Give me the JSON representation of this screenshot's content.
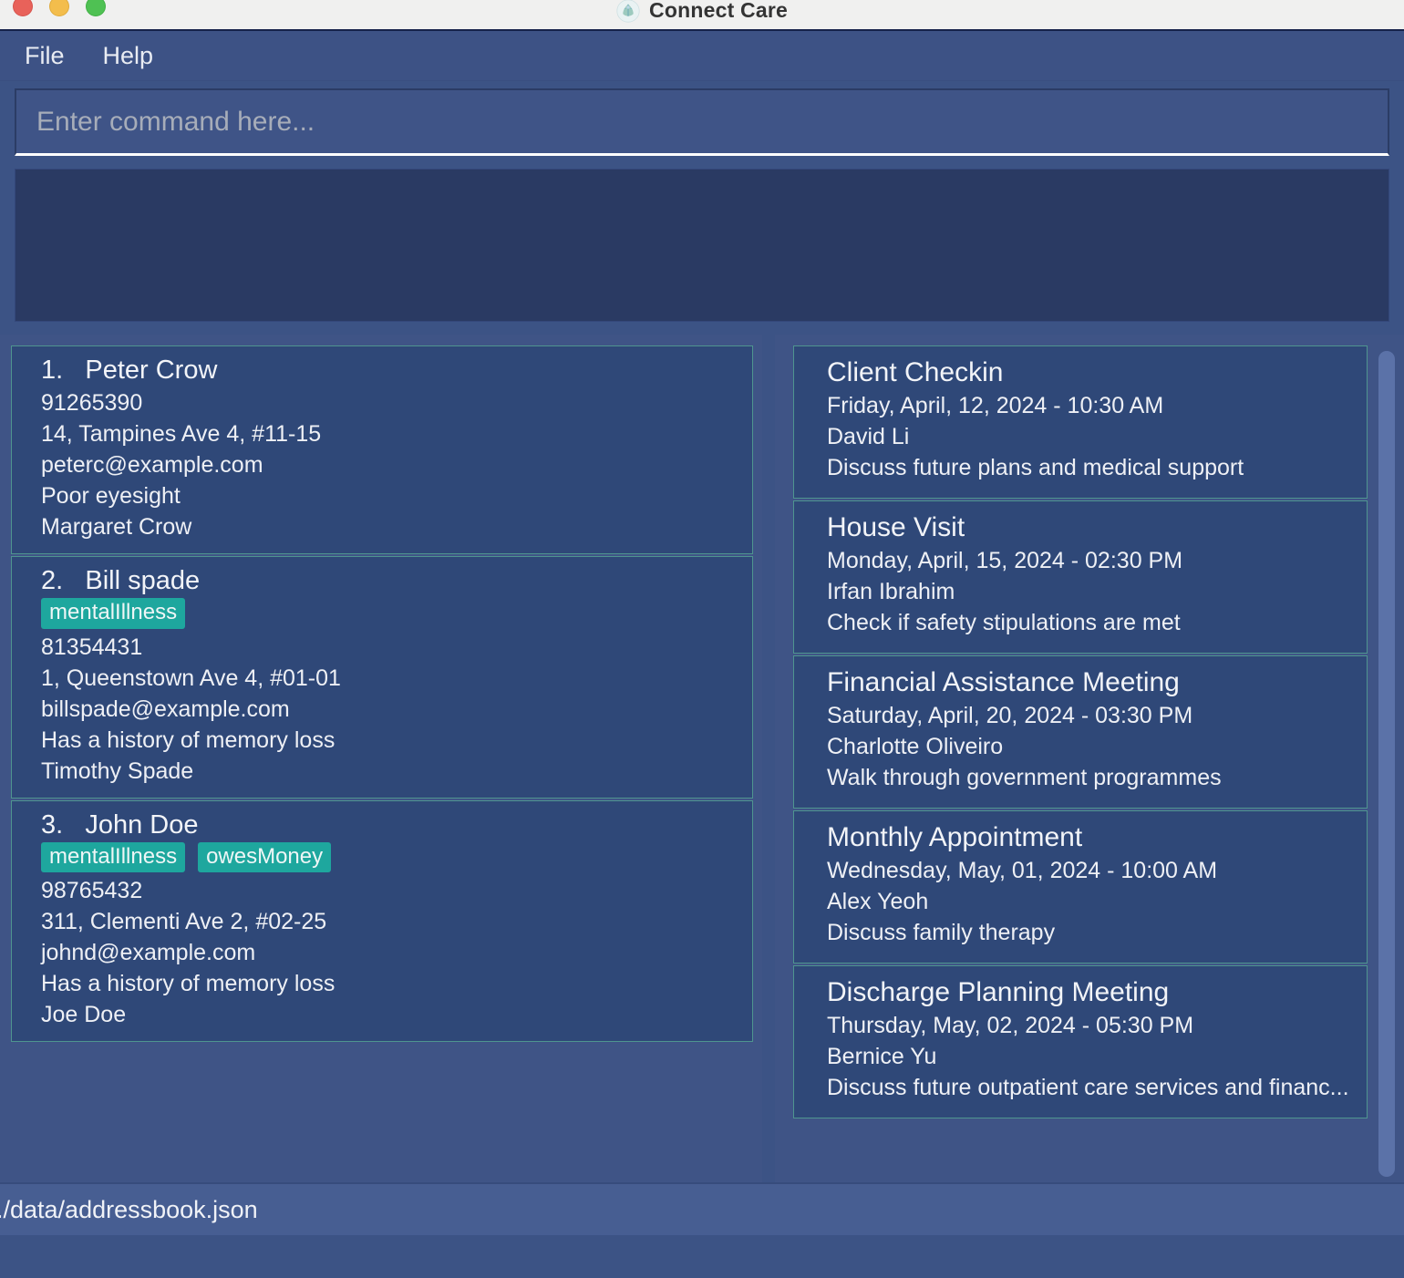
{
  "window": {
    "title": "Connect Care",
    "logo_icon": "connect-care-logo-icon",
    "traffic_lights": [
      "close-button",
      "minimize-button",
      "zoom-button"
    ]
  },
  "menubar": {
    "items": [
      {
        "label": "File"
      },
      {
        "label": "Help"
      }
    ]
  },
  "command": {
    "placeholder": "Enter command here...",
    "value": ""
  },
  "result_display": {
    "text": ""
  },
  "persons": [
    {
      "index": "1.",
      "name": "Peter Crow",
      "header": "1.   Peter Crow",
      "tags": [],
      "phone": "91265390",
      "address": "14, Tampines Ave 4, #11-15",
      "email": "peterc@example.com",
      "note": "Poor eyesight",
      "nextofkin": "Margaret Crow"
    },
    {
      "index": "2.",
      "name": "Bill spade",
      "header": "2.   Bill spade",
      "tags": [
        "mentalIllness"
      ],
      "phone": "81354431",
      "address": "1, Queenstown Ave 4, #01-01",
      "email": "billspade@example.com",
      "note": "Has a history of memory loss",
      "nextofkin": "Timothy Spade"
    },
    {
      "index": "3.",
      "name": "John Doe",
      "header": "3.   John Doe",
      "tags": [
        "mentalIllness",
        "owesMoney"
      ],
      "phone": "98765432",
      "address": "311, Clementi Ave 2, #02-25",
      "email": "johnd@example.com",
      "note": "Has a history of memory loss",
      "nextofkin": "Joe Doe"
    }
  ],
  "appointments": [
    {
      "title": "Client Checkin",
      "datetime": "Friday, April, 12, 2024 - 10:30 AM",
      "person": "David Li",
      "description": "Discuss future plans and medical support"
    },
    {
      "title": "House Visit",
      "datetime": "Monday, April, 15, 2024 - 02:30 PM",
      "person": "Irfan Ibrahim",
      "description": "Check if safety stipulations are met"
    },
    {
      "title": "Financial Assistance Meeting",
      "datetime": "Saturday, April, 20, 2024 - 03:30 PM",
      "person": "Charlotte Oliveiro",
      "description": "Walk through government programmes"
    },
    {
      "title": "Monthly Appointment",
      "datetime": "Wednesday, May, 01, 2024 - 10:00 AM",
      "person": "Alex Yeoh",
      "description": "Discuss family therapy"
    },
    {
      "title": "Discharge Planning Meeting",
      "datetime": "Thursday, May, 02, 2024 - 05:30 PM",
      "person": "Bernice Yu",
      "description": "Discuss future outpatient care services and financ..."
    }
  ],
  "statusbar": {
    "file_path": "./data/addressbook.json"
  },
  "colors": {
    "window_chrome": "#f0f0ef",
    "panel_bg": "#3f5486",
    "app_bg": "#3c5385",
    "card_bg": "#2f4878",
    "card_border": "#4f958f",
    "result_bg": "#2a3a63",
    "tag_bg": "#1ea79e",
    "statusbar_bg": "#475e92",
    "scroll_thumb": "#5b72a8",
    "text_primary": "#f2f4f8",
    "placeholder": "#a7adb9"
  }
}
